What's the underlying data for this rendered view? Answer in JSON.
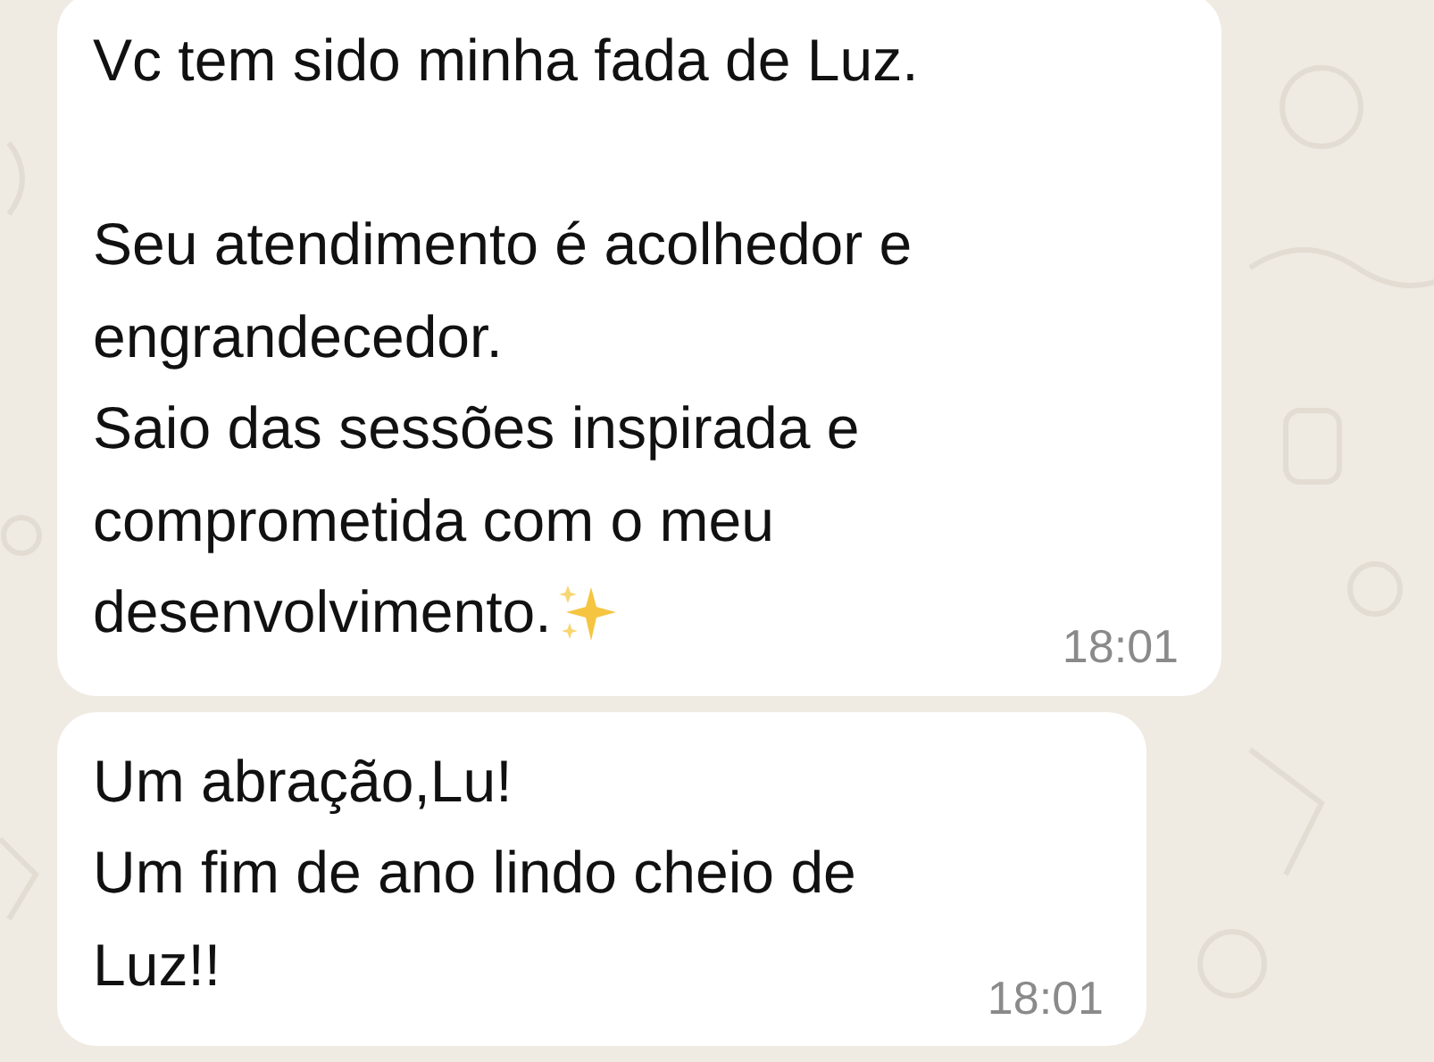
{
  "messages": [
    {
      "paragraphs": [
        [
          "Vc tem sido minha fada de Luz."
        ],
        [
          "Seu atendimento é acolhedor e",
          "engrandecedor.",
          "Saio das sessões inspirada e",
          "comprometida com o meu",
          "desenvolvimento."
        ]
      ],
      "sparkle": true,
      "time": "18:01"
    },
    {
      "paragraphs": [
        [
          "Um abração,Lu!",
          "Um fim de ano lindo cheio de",
          "Luz!!"
        ]
      ],
      "sparkle": false,
      "time": "18:01"
    }
  ]
}
